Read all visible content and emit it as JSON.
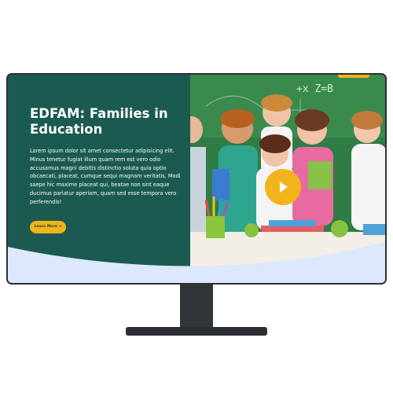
{
  "hero": {
    "title": "EDFAM: Families in Education",
    "description": "Lorem ipsum dolor sit amet consectetur adipisicing elit. Minus tenetur fugiat illum quam rem est vero odio accusamus magni debitis distinctio soluta quia optio obcaecati, placeat, cumque sequi magnam veritatis. Modi saepe hic maxime placeat qui, beatae non sint eaque ducimus pariatur aperiam, quam sed esse tempora vero perferendis!",
    "cta_label": "Learn More →"
  },
  "media": {
    "board_text": "+x Z=B",
    "play_icon": "play-icon"
  },
  "colors": {
    "primary": "#1b5a50",
    "accent": "#f2b41b",
    "wave": "#dce8fb",
    "bezel": "#2b2f33"
  }
}
